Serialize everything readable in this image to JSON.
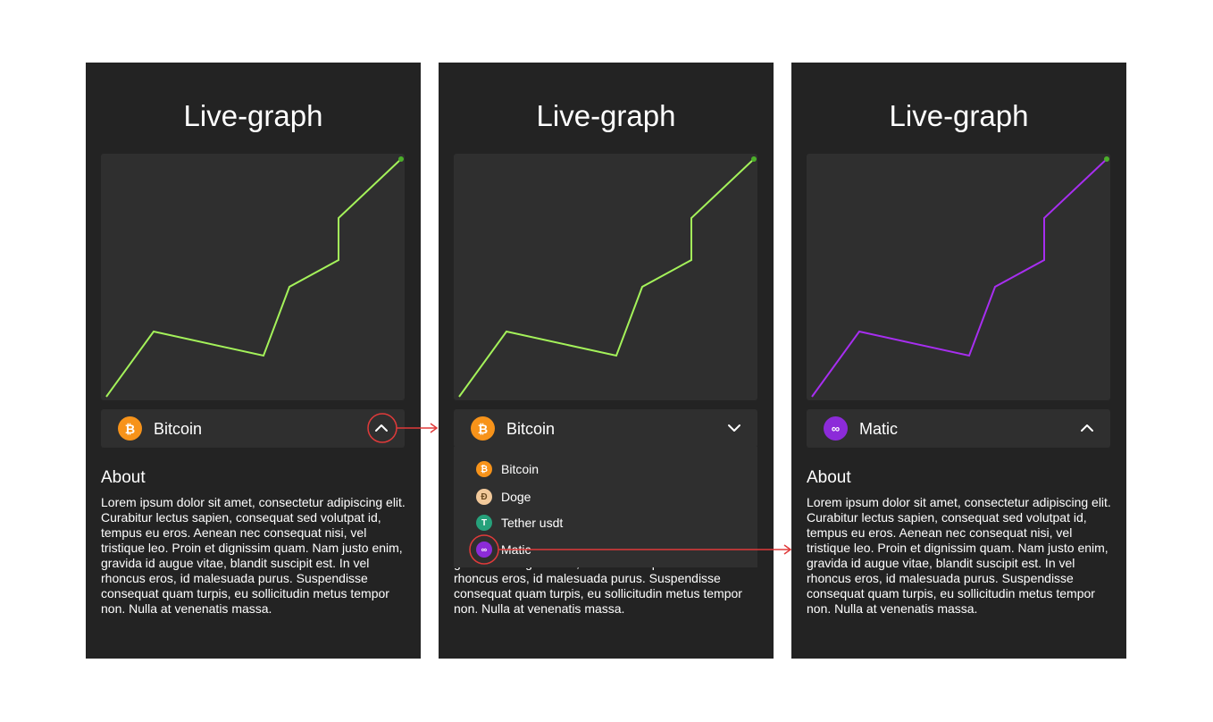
{
  "colors": {
    "bitcoin": "#f7931a",
    "doge": "#f2c99a",
    "tether": "#26a17b",
    "matic": "#8c2bd9",
    "line_green": "#a4f25a",
    "line_purple": "#a72ef0",
    "annotation_red": "#e03a3a"
  },
  "screens": [
    {
      "title": "Live-graph",
      "selected_coin": {
        "label": "Bitcoin",
        "icon": "bitcoin-icon"
      },
      "chevron": "chevron-up-icon",
      "about_title": "About",
      "about_text": "Lorem ipsum dolor sit amet, consectetur adipiscing elit. Curabitur lectus sapien, consequat sed volutpat id, tempus eu eros. Aenean nec consequat nisi, vel tristique leo. Proin et dignissim quam. Nam justo enim, gravida id augue vitae, blandit suscipit est. In vel rhoncus eros, id malesuada purus. Suspendisse consequat quam turpis, eu sollicitudin metus tempor non. Nulla at venenatis massa."
    },
    {
      "title": "Live-graph",
      "selected_coin": {
        "label": "Bitcoin",
        "icon": "bitcoin-icon"
      },
      "chevron": "chevron-down-icon",
      "dropdown_options": [
        {
          "label": "Bitcoin",
          "icon": "bitcoin-icon"
        },
        {
          "label": "Doge",
          "icon": "doge-icon"
        },
        {
          "label": "Tether usdt",
          "icon": "tether-icon"
        },
        {
          "label": "Matic",
          "icon": "matic-icon"
        }
      ],
      "about_text": "Lorem ipsum dolor sit amet, consectetur adipiscing elit. Curabitur lectus sapien, consequat sed volutpat id, tempus eu eros. Aenean nec consequat nisi, vel tristique leo. Proin et dignissim quam. Nam justo enim, gravida id augue vitae, blandit suscipit est. In vel rhoncus eros, id malesuada purus. Suspendisse consequat quam turpis, eu sollicitudin metus tempor non. Nulla at venenatis massa."
    },
    {
      "title": "Live-graph",
      "selected_coin": {
        "label": "Matic",
        "icon": "matic-icon"
      },
      "chevron": "chevron-up-icon",
      "about_title": "About",
      "about_text": "Lorem ipsum dolor sit amet, consectetur adipiscing elit. Curabitur lectus sapien, consequat sed volutpat id, tempus eu eros. Aenean nec consequat nisi, vel tristique leo. Proin et dignissim quam. Nam justo enim, gravida id augue vitae, blandit suscipit est. In vel rhoncus eros, id malesuada purus. Suspendisse consequat quam turpis, eu sollicitudin metus tempor non. Nulla at venenatis massa."
    }
  ]
}
